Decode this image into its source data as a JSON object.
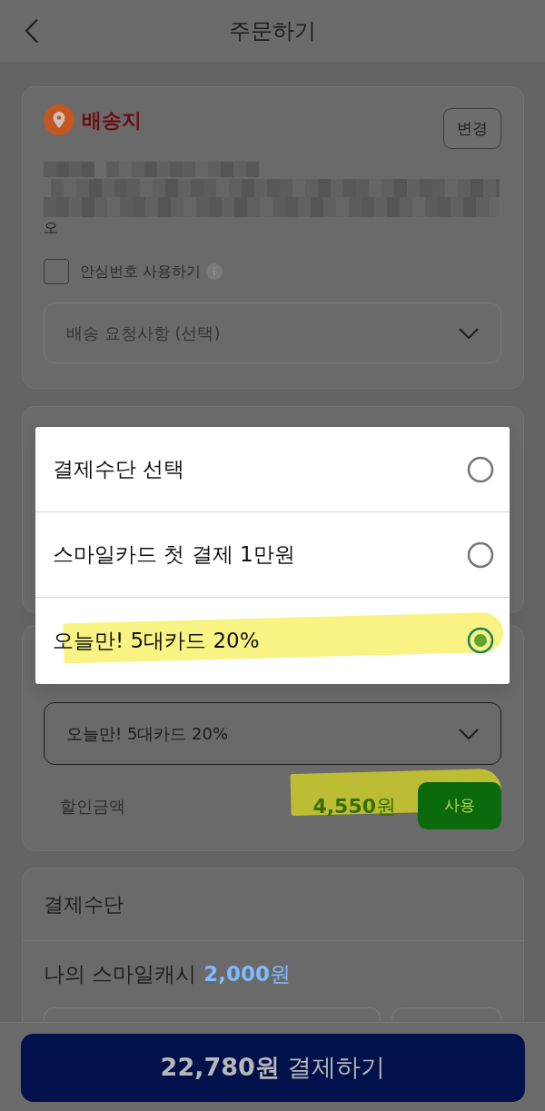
{
  "header": {
    "title": "주문하기"
  },
  "shipping": {
    "title": "배송지",
    "change_button": "변경",
    "address_tail": "오",
    "safe_number": {
      "label": "안심번호 사용하기",
      "checked": false
    },
    "request_select": {
      "placeholder": "배송 요청사항 (선택)"
    }
  },
  "discount": {
    "select_value": "오늘만! 5대카드 20%",
    "amount_label": "할인금액",
    "amount": "**4,550**원",
    "apply_button": "사용",
    "highlighted": true
  },
  "payment": {
    "title": "결제수단",
    "smile_cash_label": "나의 스마일캐시",
    "smile_cash_amount": "**2,000**원"
  },
  "pay_button": "**22,780원** 결제하기",
  "payment_options": [
    {
      "label": "결제수단 선택",
      "selected": false,
      "highlighted": false
    },
    {
      "label": "스마일카드 첫 결제 1만원",
      "selected": false,
      "highlighted": false
    },
    {
      "label": "오늘만! 5대카드 20%",
      "selected": true,
      "highlighted": true
    }
  ]
}
